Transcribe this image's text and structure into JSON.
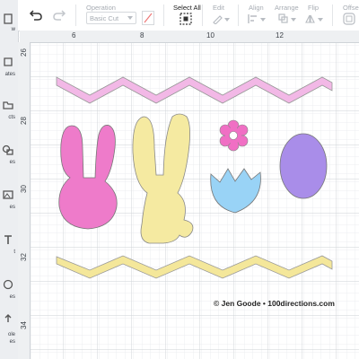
{
  "sidebar": {
    "items": [
      {
        "label": "w",
        "icon": "new-icon"
      },
      {
        "label": "ates",
        "icon": "templates-icon"
      },
      {
        "label": "cts",
        "icon": "projects-icon"
      },
      {
        "label": "es",
        "icon": "shapes-icon"
      },
      {
        "label": "es",
        "icon": "images-icon"
      },
      {
        "label": "t",
        "icon": "text-icon"
      },
      {
        "label": "es",
        "icon": "phrases-icon"
      },
      {
        "label": "ole",
        "icon": "upload-icon"
      },
      {
        "label": "es",
        "icon": "upload-icon"
      }
    ]
  },
  "toolbar": {
    "operation_label": "Operation",
    "operation_value": "Basic Cut",
    "select_all_label": "Select All",
    "edit_label": "Edit",
    "align_label": "Align",
    "arrange_label": "Arrange",
    "flip_label": "Flip",
    "offset_label": "Offse"
  },
  "rulers": {
    "x_ticks": [
      "6",
      "8",
      "10",
      "12"
    ],
    "y_ticks": [
      "26",
      "28",
      "30",
      "32",
      "34"
    ]
  },
  "canvas": {
    "copyright": "© Jen Goode • 100directions.com",
    "colors": {
      "zigzag_top": "#f2b8e6",
      "zigzag_bottom": "#f4e79a",
      "bunny_pink": "#ee7bca",
      "bunny_yellow": "#f5eaa1",
      "flower": "#f06fc4",
      "egg_shell": "#99d3f6",
      "egg_purple": "#a98de9"
    }
  }
}
